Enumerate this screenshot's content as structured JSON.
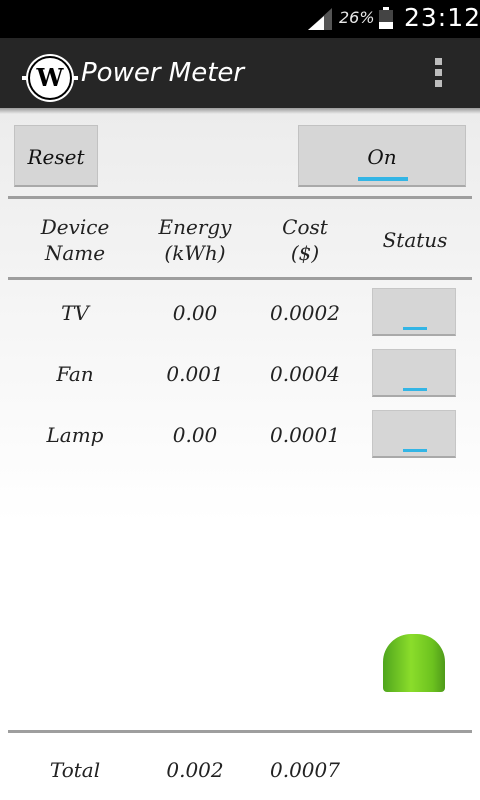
{
  "status_bar": {
    "battery_percent": "26%",
    "time": "23:12",
    "icons": [
      "signal-icon",
      "battery-icon"
    ]
  },
  "action_bar": {
    "logo_letter": "W",
    "title": "Power Meter",
    "icons": [
      "app-logo-icon",
      "overflow-menu-icon"
    ]
  },
  "controls": {
    "reset_label": "Reset",
    "toggle_label": "On"
  },
  "table": {
    "headers": {
      "device_line1": "Device",
      "device_line2": "Name",
      "energy_line1": "Energy",
      "energy_line2": "(kWh)",
      "cost_line1": "Cost",
      "cost_line2": "($)",
      "status": "Status"
    },
    "rows": [
      {
        "device": "TV",
        "energy": "0.00",
        "cost": "0.0002"
      },
      {
        "device": "Fan",
        "energy": "0.001",
        "cost": "0.0004"
      },
      {
        "device": "Lamp",
        "energy": "0.00",
        "cost": "0.0001"
      }
    ],
    "total": {
      "label": "Total",
      "energy": "0.002",
      "cost": "0.0007"
    }
  },
  "colors": {
    "accent": "#33b5e5",
    "action_bar": "#262626",
    "status_led": "#7dd12a"
  }
}
